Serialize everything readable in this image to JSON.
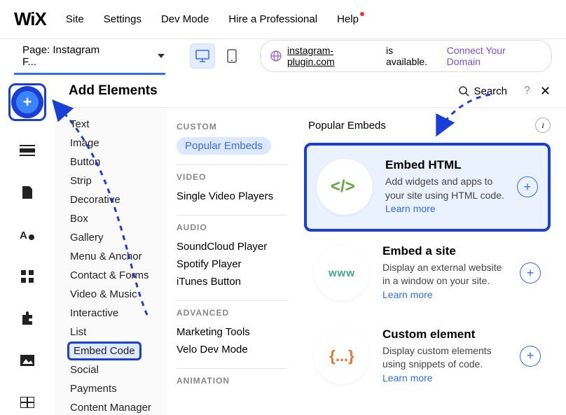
{
  "logo": "WiX",
  "topnav": [
    "Site",
    "Settings",
    "Dev Mode",
    "Hire a Professional",
    "Help"
  ],
  "page_selector": {
    "label": "Page: Instagram F..."
  },
  "domain_bar": {
    "domain": "instagram-plugin.com",
    "avail_text": "is available.",
    "connect": "Connect Your Domain"
  },
  "panel": {
    "title": "Add Elements",
    "search_placeholder": "Search",
    "categories": [
      "Text",
      "Image",
      "Button",
      "Strip",
      "Decorative",
      "Box",
      "Gallery",
      "Menu & Anchor",
      "Contact & Forms",
      "Video & Music",
      "Interactive",
      "List",
      "Embed Code",
      "Social",
      "Payments",
      "Content Manager"
    ],
    "selected_category": "Embed Code",
    "sub": {
      "custom_label": "CUSTOM",
      "custom_items": [
        "Popular Embeds"
      ],
      "video_label": "VIDEO",
      "video_items": [
        "Single Video Players"
      ],
      "audio_label": "AUDIO",
      "audio_items": [
        "SoundCloud Player",
        "Spotify Player",
        "iTunes Button"
      ],
      "advanced_label": "ADVANCED",
      "advanced_items": [
        "Marketing Tools",
        "Velo Dev Mode"
      ],
      "animation_label": "ANIMATION"
    },
    "embeds_header": "Popular Embeds",
    "cards": [
      {
        "title": "Embed HTML",
        "desc": "Add widgets and apps to your site using HTML code.",
        "learn": "Learn more",
        "icon": "code"
      },
      {
        "title": "Embed a site",
        "desc": "Display an external website in a window on your site.",
        "learn": "Learn more",
        "icon": "www"
      },
      {
        "title": "Custom element",
        "desc": "Display custom elements using snippets of code.",
        "learn": "Learn more",
        "icon": "braces"
      }
    ]
  }
}
